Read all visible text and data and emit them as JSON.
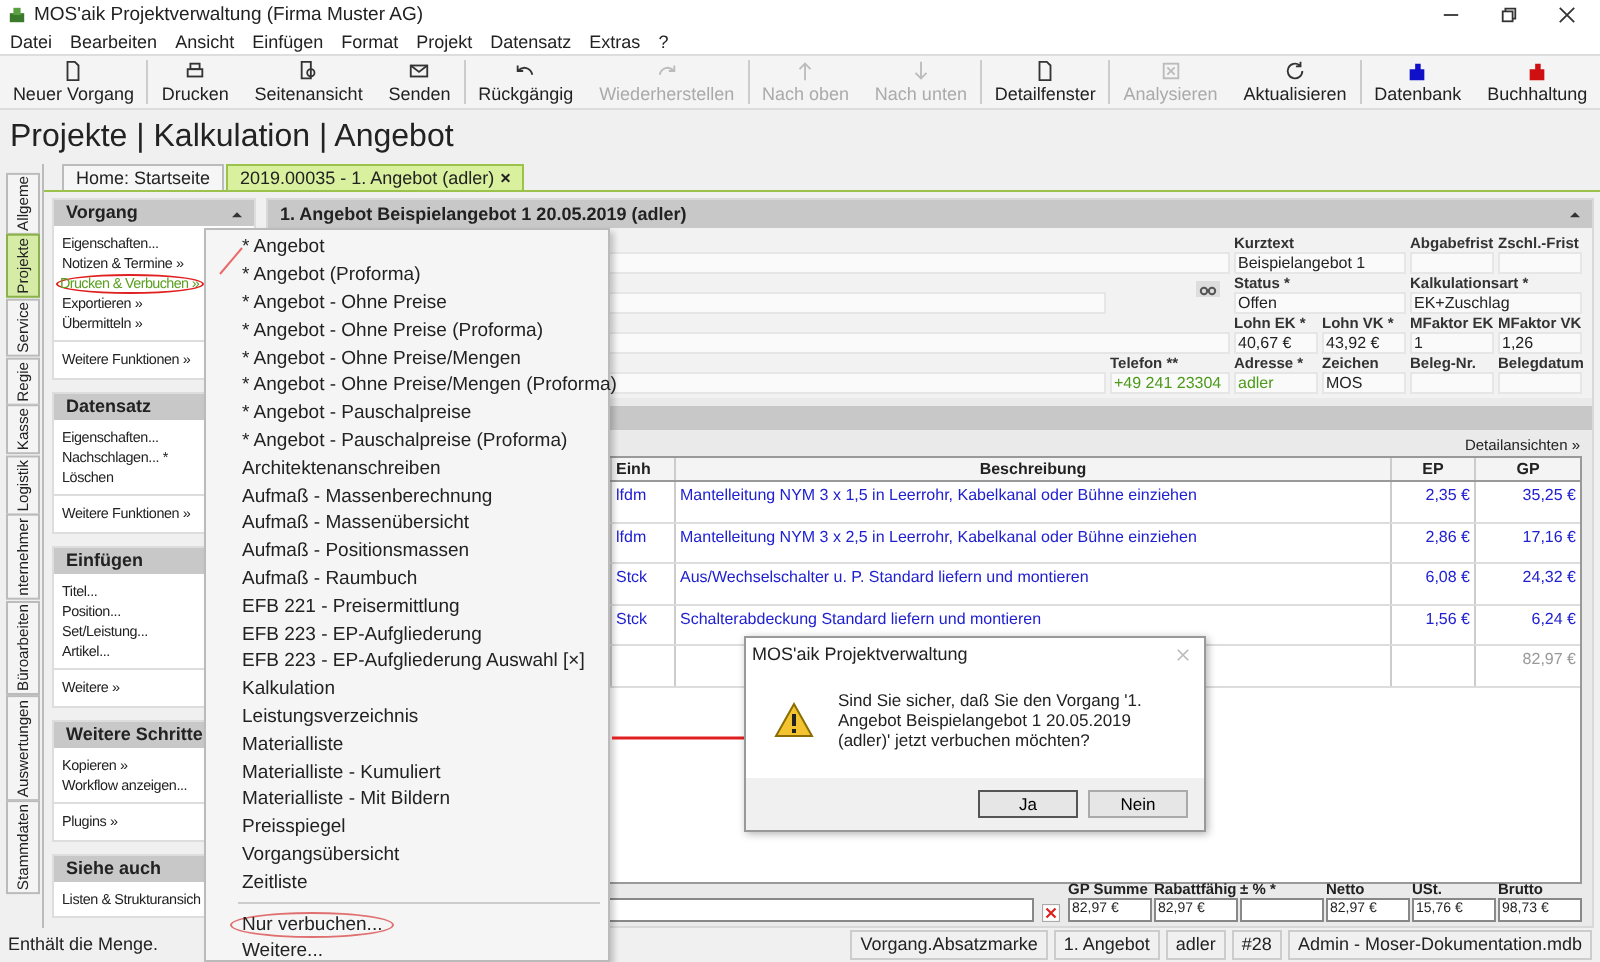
{
  "window": {
    "title": "MOS'aik Projektverwaltung (Firma Muster AG)"
  },
  "menu_bar": [
    "Datei",
    "Bearbeiten",
    "Ansicht",
    "Einfügen",
    "Format",
    "Projekt",
    "Datensatz",
    "Extras",
    "?"
  ],
  "toolbar": [
    {
      "label": "Neuer Vorgang",
      "disabled": false
    },
    {
      "label": "Drucken",
      "disabled": false
    },
    {
      "label": "Seitenansicht",
      "disabled": false
    },
    {
      "label": "Senden",
      "disabled": false
    },
    {
      "label": "Rückgängig",
      "disabled": false
    },
    {
      "label": "Wiederherstellen",
      "disabled": true
    },
    {
      "label": "Nach oben",
      "disabled": true
    },
    {
      "label": "Nach unten",
      "disabled": true
    },
    {
      "label": "Detailfenster",
      "disabled": false
    },
    {
      "label": "Analysieren",
      "disabled": true
    },
    {
      "label": "Aktualisieren",
      "disabled": false
    },
    {
      "label": "Datenbank",
      "disabled": false
    },
    {
      "label": "Buchhaltung",
      "disabled": false
    }
  ],
  "heading": "Projekte | Kalkulation | Angebot",
  "side_tabs": [
    {
      "label": "Allgeme",
      "selected": false
    },
    {
      "label": "Projekte",
      "selected": true
    },
    {
      "label": "Service",
      "selected": false
    },
    {
      "label": "Regie",
      "selected": false
    },
    {
      "label": "Kasse",
      "selected": false
    },
    {
      "label": "Logistik",
      "selected": false
    },
    {
      "label": "nternehmer",
      "selected": false
    },
    {
      "label": "Büroarbeiten",
      "selected": false
    },
    {
      "label": "Auswertungen",
      "selected": false
    },
    {
      "label": "Stammdaten",
      "selected": false
    }
  ],
  "doc_tabs": [
    {
      "label": "Home: Startseite",
      "selected": false
    },
    {
      "label": "2019.00035 - 1. Angebot (adler)",
      "selected": true,
      "close": "×"
    }
  ],
  "task_panel": [
    {
      "title": "Vorgang",
      "groups": [
        [
          {
            "label": "Eigenschaften...",
            "selected": false
          },
          {
            "label": "Notizen & Termine »",
            "selected": false
          },
          {
            "label": "Drucken & Verbuchen »",
            "selected": true
          },
          {
            "label": "Exportieren »",
            "selected": false
          },
          {
            "label": "Übermitteln »",
            "selected": false
          }
        ],
        [
          {
            "label": "Weitere Funktionen »",
            "selected": false
          }
        ]
      ]
    },
    {
      "title": "Datensatz",
      "groups": [
        [
          {
            "label": "Eigenschaften...",
            "selected": false
          },
          {
            "label": "Nachschlagen... *",
            "selected": false
          },
          {
            "label": "Löschen",
            "selected": false
          }
        ],
        [
          {
            "label": "Weitere Funktionen »",
            "selected": false
          }
        ]
      ]
    },
    {
      "title": "Einfügen",
      "groups": [
        [
          {
            "label": "Titel...",
            "selected": false
          },
          {
            "label": "Position...",
            "selected": false
          },
          {
            "label": "Set/Leistung...",
            "selected": false
          },
          {
            "label": "Artikel...",
            "selected": false
          }
        ],
        [
          {
            "label": "Weitere »",
            "selected": false
          }
        ]
      ]
    },
    {
      "title": "Weitere Schritte",
      "groups": [
        [
          {
            "label": "Kopieren »",
            "selected": false
          },
          {
            "label": "Workflow anzeigen...",
            "selected": false
          }
        ],
        [
          {
            "label": "Plugins »",
            "selected": false
          }
        ]
      ]
    },
    {
      "title": "Siehe auch",
      "groups": [
        [
          {
            "label": "Listen & Strukturansich",
            "selected": false
          }
        ]
      ]
    }
  ],
  "document": {
    "title": "1. Angebot Beispielangebot 1 20.05.2019 (adler)",
    "fields": [
      {
        "label": "Kurztext",
        "value": "Beispielangebot 1",
        "kind": "text"
      },
      {
        "label": "Abgabefrist",
        "kind": "text"
      },
      {
        "label": "Zschl.-Frist",
        "kind": "text"
      },
      {
        "label": "Status *",
        "value": "Offen",
        "kind": "text"
      },
      {
        "label": "Kalkulationsart *",
        "value": "EK+Zuschlag",
        "kind": "text"
      },
      {
        "label": "Lohn EK *",
        "value": "40,67 €",
        "kind": "text"
      },
      {
        "label": "Lohn VK *",
        "value": "43,92 €",
        "kind": "text"
      },
      {
        "label": "MFaktor EK",
        "value": "1",
        "kind": "text"
      },
      {
        "label": "MFaktor VK",
        "value": "1,26",
        "kind": "text"
      },
      {
        "label": "Telefon **",
        "value": "+49 241 23304",
        "kind": "link"
      },
      {
        "label": "Adresse *",
        "value": "adler",
        "kind": "link"
      },
      {
        "label": "Zeichen",
        "value": "MOS",
        "kind": "text"
      },
      {
        "label": "Beleg-Nr.",
        "kind": "text"
      },
      {
        "label": "Belegdatum",
        "kind": "text"
      }
    ]
  },
  "positions": {
    "link": "Detailansichten »",
    "columns": [
      "Einh",
      "Beschreibung",
      "EP",
      "GP"
    ],
    "rows": [
      [
        "lfdm",
        "Mantelleitung NYM 3 x 1,5 in Leerrohr, Kabelkanal oder Bühne einziehen",
        "2,35 €",
        "35,25 €"
      ],
      [
        "lfdm",
        "Mantelleitung NYM 3 x 2,5 in Leerrohr, Kabelkanal oder Bühne einziehen",
        "2,86 €",
        "17,16 €"
      ],
      [
        "Stck",
        "Aus/Wechselschalter u. P. Standard liefern und montieren",
        "6,08 €",
        "24,32 €"
      ],
      [
        "Stck",
        "Schalterabdeckung Standard liefern und montieren",
        "1,56 €",
        "6,24 €"
      ]
    ],
    "total": "82,97 €"
  },
  "totals": [
    {
      "label": "GP Summe",
      "value": "82,97 €"
    },
    {
      "label": "Rabattfähig",
      "value": "82,97 €"
    },
    {
      "label": "± % *"
    },
    {
      "label": "Netto",
      "value": "82,97 €"
    },
    {
      "label": "USt.",
      "value": "15,76 €"
    },
    {
      "label": "Brutto",
      "value": "98,73 €"
    }
  ],
  "context_menu": {
    "groups": [
      [
        {
          "label": "* Angebot",
          "selected": false
        },
        {
          "label": "* Angebot (Proforma)",
          "selected": false
        },
        {
          "label": "* Angebot - Ohne Preise",
          "selected": false
        },
        {
          "label": "* Angebot - Ohne Preise (Proforma)",
          "selected": false
        },
        {
          "label": "* Angebot - Ohne Preise/Mengen",
          "selected": false
        },
        {
          "label": "* Angebot - Ohne Preise/Mengen (Proforma)",
          "selected": false
        },
        {
          "label": "* Angebot - Pauschalpreise",
          "selected": false
        },
        {
          "label": "* Angebot - Pauschalpreise (Proforma)",
          "selected": false
        },
        {
          "label": "Architektenanschreiben",
          "selected": false
        },
        {
          "label": "Aufmaß - Massenberechnung",
          "selected": false
        },
        {
          "label": "Aufmaß - Massenübersicht",
          "selected": false
        },
        {
          "label": "Aufmaß - Positionsmassen",
          "selected": false
        },
        {
          "label": "Aufmaß - Raumbuch",
          "selected": false
        },
        {
          "label": "EFB 221 - Preisermittlung",
          "selected": false
        },
        {
          "label": "EFB 223 - EP-Aufgliederung",
          "selected": false
        },
        {
          "label": "EFB 223 - EP-Aufgliederung Auswahl [×]",
          "selected": false
        },
        {
          "label": "Kalkulation",
          "selected": false
        },
        {
          "label": "Leistungsverzeichnis",
          "selected": false
        },
        {
          "label": "Materialliste",
          "selected": false
        },
        {
          "label": "Materialliste - Kumuliert",
          "selected": false
        },
        {
          "label": "Materialliste - Mit Bildern",
          "selected": false
        },
        {
          "label": "Preisspiegel",
          "selected": false
        },
        {
          "label": "Vorgangsübersicht",
          "selected": false
        },
        {
          "label": "Zeitliste",
          "selected": false
        }
      ],
      [
        {
          "label": "Nur verbuchen...",
          "selected": true
        },
        {
          "label": "Weitere...",
          "selected": false
        }
      ]
    ]
  },
  "dialog": {
    "title": "MOS'aik Projektverwaltung",
    "message": "Sind Sie sicher, daß Sie den Vorgang '1. Angebot Beispielangebot 1 20.05.2019 (adler)' jetzt verbuchen möchten?",
    "buttons": [
      "Ja",
      "Nein"
    ]
  },
  "status_bar": [
    "Enthält die Menge.",
    "Vorgang.Absatzmarke",
    "1. Angebot",
    "adler",
    "#28",
    "Admin - Moser-Dokumentation.mdb"
  ]
}
